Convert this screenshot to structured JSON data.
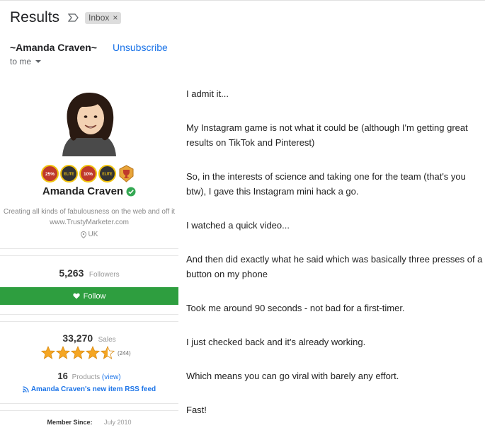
{
  "email": {
    "subject": "Results",
    "label_chip": "Inbox",
    "label_close": "×",
    "sender": "~Amanda Craven~",
    "unsubscribe": "Unsubscribe",
    "recipient": "to me"
  },
  "profile": {
    "badges": [
      "25%",
      "ELITE",
      "10%",
      "ELITE",
      "trophy"
    ],
    "name": "Amanda Craven",
    "tagline": "Creating all kinds of fabulousness on the web and off it",
    "website": "www.TrustyMarketer.com",
    "location": "UK",
    "followers_count": "5,263",
    "followers_label": "Followers",
    "follow_button": "Follow",
    "sales_count": "33,270",
    "sales_label": "Sales",
    "rating": 4.5,
    "rating_count": "(244)",
    "products_count": "16",
    "products_label": "Products",
    "products_view": "(view)",
    "rss_label": "Amanda Craven's new item RSS feed",
    "member_since_label": "Member Since:",
    "member_since_value": "July 2010"
  },
  "body": {
    "paragraphs": [
      "I admit it...",
      "My Instagram game is not what it could be (although I'm getting great results on TikTok and Pinterest)",
      "So, in the interests of science and taking one for the team (that's you btw), I gave this Instagram mini hack a go.",
      "I watched a quick video...",
      "And then did exactly what he said which was basically three presses of a button on my phone",
      "Took me around 90 seconds - not bad for a first-timer.",
      "I just checked back and it's already working.",
      "Which means you can go viral with barely any effort.",
      "Fast!"
    ]
  },
  "colors": {
    "link": "#1a73e8",
    "follow_green": "#2e9e3f",
    "verified_green": "#34a853",
    "star_gold": "#f5a623"
  }
}
